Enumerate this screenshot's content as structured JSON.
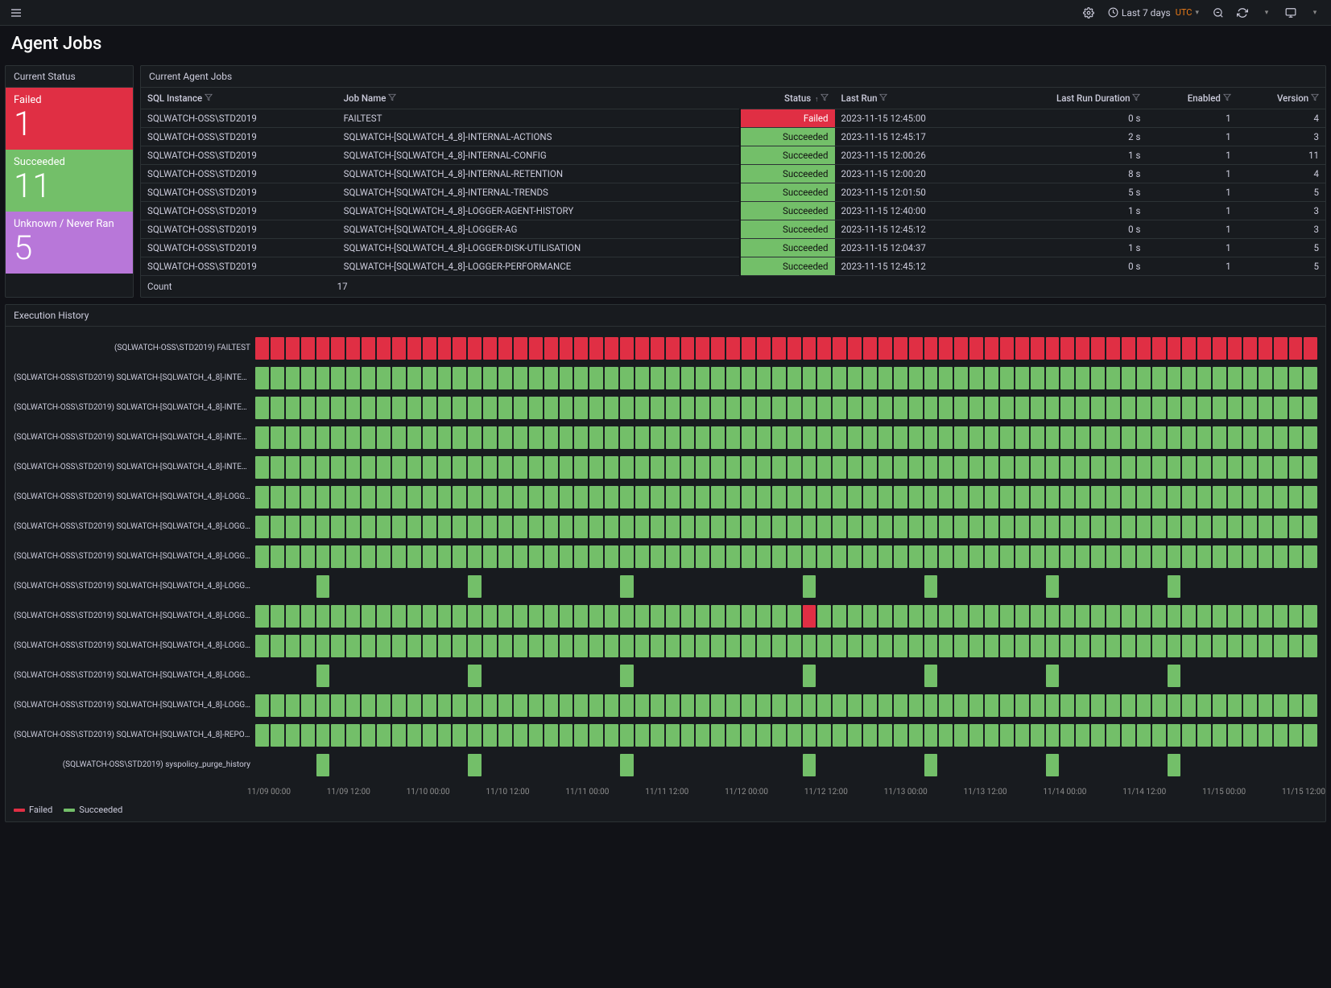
{
  "header": {
    "time_range": "Last 7 days",
    "timezone": "UTC"
  },
  "page_title": "Agent Jobs",
  "status_panel": {
    "title": "Current Status",
    "tiles": [
      {
        "label": "Failed",
        "value": "1",
        "tone": "red-bg"
      },
      {
        "label": "Succeeded",
        "value": "11",
        "tone": "green-bg"
      },
      {
        "label": "Unknown / Never Ran",
        "value": "5",
        "tone": "purple-bg"
      }
    ]
  },
  "jobs_table": {
    "title": "Current Agent Jobs",
    "columns": {
      "sql_instance": "SQL Instance",
      "job_name": "Job Name",
      "status": "Status",
      "last_run": "Last Run",
      "last_run_duration": "Last Run Duration",
      "enabled": "Enabled",
      "version": "Version"
    },
    "rows": [
      {
        "sql_instance": "SQLWATCH-OSS\\STD2019",
        "job_name": "FAILTEST",
        "status": "Failed",
        "last_run": "2023-11-15 12:45:00",
        "duration": "0 s",
        "enabled": "1",
        "version": "4"
      },
      {
        "sql_instance": "SQLWATCH-OSS\\STD2019",
        "job_name": "SQLWATCH-[SQLWATCH_4_8]-INTERNAL-ACTIONS",
        "status": "Succeeded",
        "last_run": "2023-11-15 12:45:17",
        "duration": "2 s",
        "enabled": "1",
        "version": "3"
      },
      {
        "sql_instance": "SQLWATCH-OSS\\STD2019",
        "job_name": "SQLWATCH-[SQLWATCH_4_8]-INTERNAL-CONFIG",
        "status": "Succeeded",
        "last_run": "2023-11-15 12:00:26",
        "duration": "1 s",
        "enabled": "1",
        "version": "11"
      },
      {
        "sql_instance": "SQLWATCH-OSS\\STD2019",
        "job_name": "SQLWATCH-[SQLWATCH_4_8]-INTERNAL-RETENTION",
        "status": "Succeeded",
        "last_run": "2023-11-15 12:00:20",
        "duration": "8 s",
        "enabled": "1",
        "version": "4"
      },
      {
        "sql_instance": "SQLWATCH-OSS\\STD2019",
        "job_name": "SQLWATCH-[SQLWATCH_4_8]-INTERNAL-TRENDS",
        "status": "Succeeded",
        "last_run": "2023-11-15 12:01:50",
        "duration": "5 s",
        "enabled": "1",
        "version": "5"
      },
      {
        "sql_instance": "SQLWATCH-OSS\\STD2019",
        "job_name": "SQLWATCH-[SQLWATCH_4_8]-LOGGER-AGENT-HISTORY",
        "status": "Succeeded",
        "last_run": "2023-11-15 12:40:00",
        "duration": "1 s",
        "enabled": "1",
        "version": "3"
      },
      {
        "sql_instance": "SQLWATCH-OSS\\STD2019",
        "job_name": "SQLWATCH-[SQLWATCH_4_8]-LOGGER-AG",
        "status": "Succeeded",
        "last_run": "2023-11-15 12:45:12",
        "duration": "0 s",
        "enabled": "1",
        "version": "3"
      },
      {
        "sql_instance": "SQLWATCH-OSS\\STD2019",
        "job_name": "SQLWATCH-[SQLWATCH_4_8]-LOGGER-DISK-UTILISATION",
        "status": "Succeeded",
        "last_run": "2023-11-15 12:04:37",
        "duration": "1 s",
        "enabled": "1",
        "version": "5"
      },
      {
        "sql_instance": "SQLWATCH-OSS\\STD2019",
        "job_name": "SQLWATCH-[SQLWATCH_4_8]-LOGGER-PERFORMANCE",
        "status": "Succeeded",
        "last_run": "2023-11-15 12:45:12",
        "duration": "0 s",
        "enabled": "1",
        "version": "5"
      }
    ],
    "footer": {
      "label": "Count",
      "value": "17"
    }
  },
  "exec_history": {
    "title": "Execution History",
    "legend": {
      "failed": "Failed",
      "succeeded": "Succeeded"
    },
    "cols": 70,
    "sparse": [
      4,
      14,
      24,
      36,
      44,
      52,
      60
    ],
    "axis": [
      "11/09 00:00",
      "11/09 12:00",
      "11/10 00:00",
      "11/10 12:00",
      "11/11 00:00",
      "11/11 12:00",
      "11/12 00:00",
      "11/12 12:00",
      "11/13 00:00",
      "11/13 12:00",
      "11/14 00:00",
      "11/14 12:00",
      "11/15 00:00",
      "11/15 12:00"
    ],
    "rows": [
      {
        "label": "(SQLWATCH-OSS\\STD2019) FAILTEST",
        "kind": "full",
        "color": "r"
      },
      {
        "label": "(SQLWATCH-OSS\\STD2019) SQLWATCH-[SQLWATCH_4_8]-INTERNAL-ACTIONS",
        "kind": "full",
        "color": "g"
      },
      {
        "label": "(SQLWATCH-OSS\\STD2019) SQLWATCH-[SQLWATCH_4_8]-INTERNAL-CONFIG",
        "kind": "full",
        "color": "g"
      },
      {
        "label": "(SQLWATCH-OSS\\STD2019) SQLWATCH-[SQLWATCH_4_8]-INTERNAL-RETENTION",
        "kind": "full",
        "color": "g"
      },
      {
        "label": "(SQLWATCH-OSS\\STD2019) SQLWATCH-[SQLWATCH_4_8]-INTERNAL-TRENDS",
        "kind": "full",
        "color": "g"
      },
      {
        "label": "(SQLWATCH-OSS\\STD2019) SQLWATCH-[SQLWATCH_4_8]-LOGGER-AG",
        "kind": "full",
        "color": "g"
      },
      {
        "label": "(SQLWATCH-OSS\\STD2019) SQLWATCH-[SQLWATCH_4_8]-LOGGER-AGENT-HISTORY",
        "kind": "full",
        "color": "g"
      },
      {
        "label": "(SQLWATCH-OSS\\STD2019) SQLWATCH-[SQLWATCH_4_8]-LOGGER-DISK-UTILISATION",
        "kind": "full",
        "color": "g"
      },
      {
        "label": "(SQLWATCH-OSS\\STD2019) SQLWATCH-[SQLWATCH_4_8]-LOGGER-INDEXES",
        "kind": "sparse",
        "color": "g"
      },
      {
        "label": "(SQLWATCH-OSS\\STD2019) SQLWATCH-[SQLWATCH_4_8]-LOGGER-PERFORMANCE",
        "kind": "full",
        "color": "g",
        "redAt": [
          36
        ]
      },
      {
        "label": "(SQLWATCH-OSS\\STD2019) SQLWATCH-[SQLWATCH_4_8]-LOGGER-PROCS",
        "kind": "full",
        "color": "g"
      },
      {
        "label": "(SQLWATCH-OSS\\STD2019) SQLWATCH-[SQLWATCH_4_8]-LOGGER-SYSCONFIG",
        "kind": "sparse",
        "color": "g"
      },
      {
        "label": "(SQLWATCH-OSS\\STD2019) SQLWATCH-[SQLWATCH_4_8]-LOGGER-XES",
        "kind": "full",
        "color": "g"
      },
      {
        "label": "(SQLWATCH-OSS\\STD2019) SQLWATCH-[SQLWATCH_4_8]-REPORT-AZMONITOR",
        "kind": "full",
        "color": "g"
      },
      {
        "label": "(SQLWATCH-OSS\\STD2019) syspolicy_purge_history",
        "kind": "sparse",
        "color": "g"
      }
    ]
  }
}
